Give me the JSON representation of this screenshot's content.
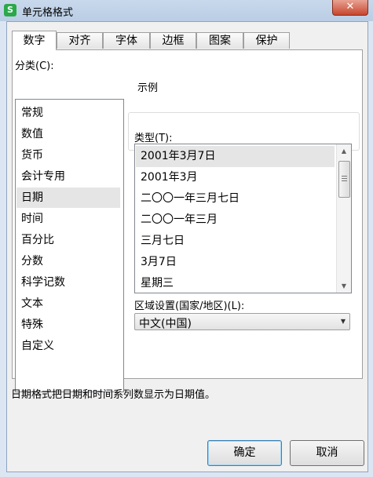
{
  "window": {
    "title": "单元格格式",
    "close_label": "✕"
  },
  "tabs": [
    {
      "label": "数字"
    },
    {
      "label": "对齐"
    },
    {
      "label": "字体"
    },
    {
      "label": "边框"
    },
    {
      "label": "图案"
    },
    {
      "label": "保护"
    }
  ],
  "category": {
    "label": "分类(C):",
    "items": [
      "常规",
      "数值",
      "货币",
      "会计专用",
      "日期",
      "时间",
      "百分比",
      "分数",
      "科学记数",
      "文本",
      "特殊",
      "自定义"
    ],
    "selected": "日期"
  },
  "sample": {
    "label": "示例"
  },
  "type": {
    "label": "类型(T):",
    "items": [
      "2001年3月7日",
      "2001年3月",
      "二〇〇一年三月七日",
      "二〇〇一年三月",
      "三月七日",
      "3月7日",
      "星期三"
    ],
    "selected": "2001年3月7日"
  },
  "locale": {
    "label": "区域设置(国家/地区)(L):",
    "value": "中文(中国)"
  },
  "description": "日期格式把日期和时间系列数显示为日期值。",
  "buttons": {
    "ok": "确定",
    "cancel": "取消"
  }
}
